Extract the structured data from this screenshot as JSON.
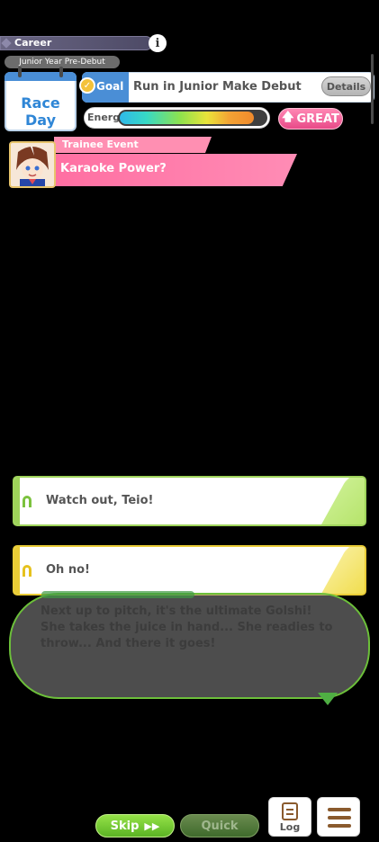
{
  "header": {
    "career_label": "Career",
    "info_symbol": "i",
    "year_label": "Junior Year Pre-Debut"
  },
  "calendar": {
    "label": "Race Day"
  },
  "goal": {
    "tab_label": "Goal",
    "text": "Run in Junior Make Debut",
    "details_label": "Details"
  },
  "energy": {
    "label": "Energy",
    "level_fraction": 0.92,
    "mood_label": "GREAT"
  },
  "event": {
    "type_label": "Trainee Event",
    "title": "Karaoke Power?"
  },
  "choices": [
    {
      "text": "Watch out, Teio!",
      "color": "#9ed35a"
    },
    {
      "text": "Oh no!",
      "color": "#e9cc36"
    }
  ],
  "dialogue": {
    "text": "Next up to pitch, it's the ultimate Golshi! She takes the juice in hand... She readies to throw... And there it goes!"
  },
  "controls": {
    "skip_label": "Skip",
    "quick_label": "Quick",
    "log_label": "Log"
  },
  "colors": {
    "accent_blue": "#4a8ed6",
    "accent_pink": "#ff6fa2",
    "accent_green": "#6cbf3a"
  }
}
